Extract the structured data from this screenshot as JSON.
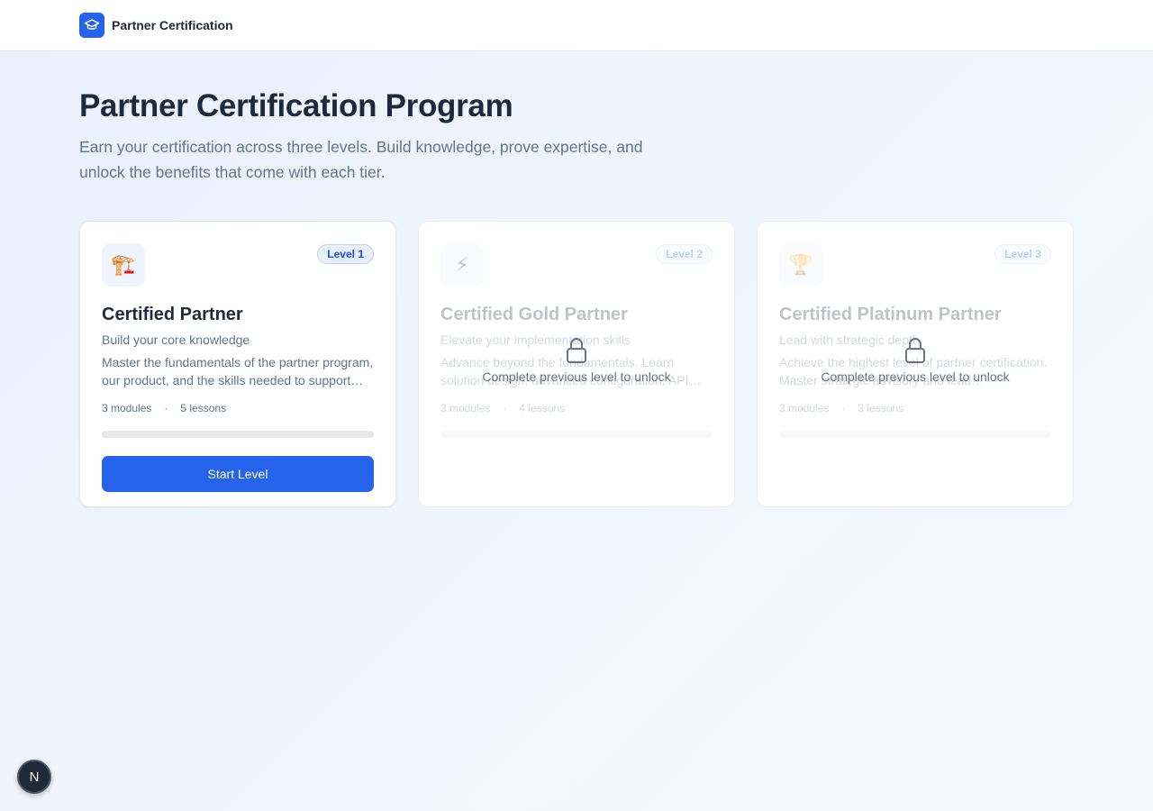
{
  "header": {
    "brand": "Partner Certification",
    "logo_icon": "graduation-cap-icon"
  },
  "hero": {
    "title": "Partner Certification Program",
    "subtitle": "Earn your certification across three levels. Build knowledge, prove expertise, and unlock the benefits that come with each tier."
  },
  "levels": [
    {
      "badge": "Level 1",
      "icon": "🏗️",
      "icon_name": "crane-icon",
      "title": "Certified Partner",
      "subtitle": "Build your core knowledge",
      "description": "Master the fundamentals of the partner program, our product, and the skills needed to support your customers.",
      "modules": "3 modules",
      "lessons": "5 lessons",
      "progress": 0,
      "action": "Start Level",
      "locked": false
    },
    {
      "badge": "Level 2",
      "icon": "⚡",
      "icon_name": "lightning-icon",
      "title": "Certified Gold Partner",
      "subtitle": "Elevate your implementation skills",
      "description": "Advance beyond the fundamentals. Learn solution design, advanced configuration, API integrations and more.",
      "modules": "3 modules",
      "lessons": "4 lessons",
      "progress": 0,
      "locked": true,
      "lock_text": "Complete previous level to unlock"
    },
    {
      "badge": "Level 3",
      "icon": "🏆",
      "icon_name": "trophy-icon",
      "title": "Certified Platinum Partner",
      "subtitle": "Lead with strategic depth",
      "description": "Achieve the highest level of partner certification. Master strategic advisory and lead transformation.",
      "modules": "3 modules",
      "lessons": "3 lessons",
      "progress": 0,
      "locked": true,
      "lock_text": "Complete previous level to unlock"
    }
  ],
  "dev_badge": {
    "label": "N"
  },
  "colors": {
    "accent": "#2563eb",
    "text": "#1e293b",
    "muted": "#64748b"
  }
}
